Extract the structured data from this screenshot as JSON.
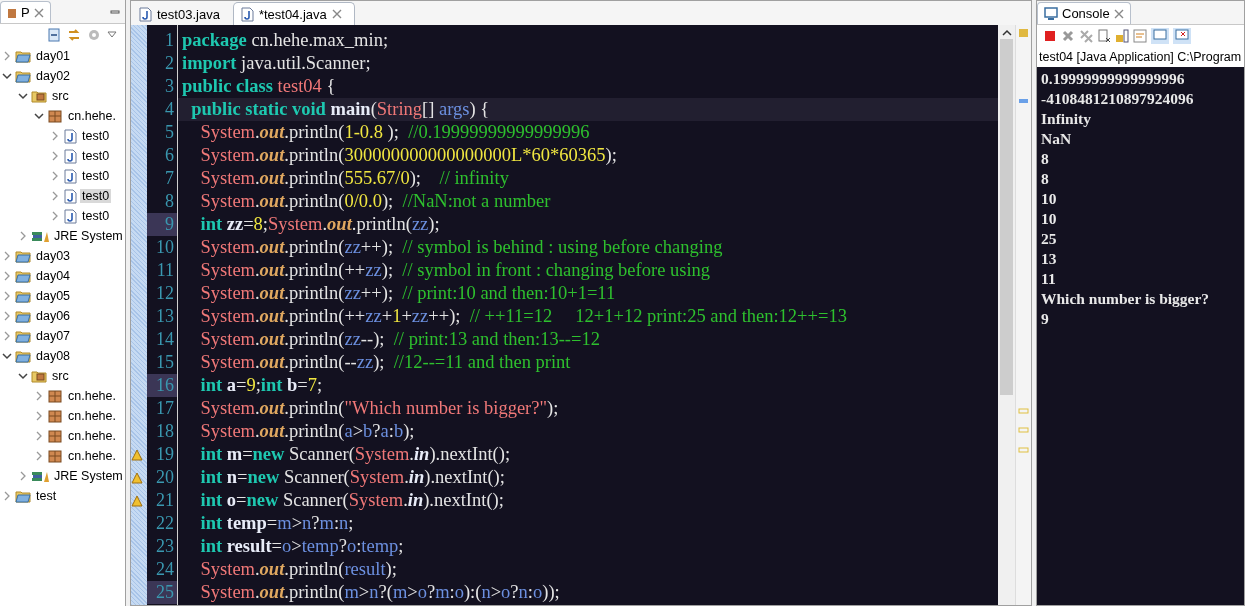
{
  "explorer": {
    "tab": "P",
    "tree": [
      {
        "label": "day01",
        "kind": "project",
        "expanded": false,
        "selected": false
      },
      {
        "label": "day02",
        "kind": "project",
        "expanded": true,
        "selected": false,
        "children": [
          {
            "label": "src",
            "kind": "source-folder",
            "expanded": true,
            "selected": false,
            "children": [
              {
                "label": "cn.hehe.",
                "kind": "package",
                "expanded": true,
                "selected": false,
                "children": [
                  {
                    "label": "test0",
                    "kind": "java-file",
                    "expanded": false,
                    "selected": false
                  },
                  {
                    "label": "test0",
                    "kind": "java-file",
                    "expanded": false,
                    "selected": false
                  },
                  {
                    "label": "test0",
                    "kind": "java-file",
                    "expanded": false,
                    "selected": false
                  },
                  {
                    "label": "test0",
                    "kind": "java-file",
                    "expanded": false,
                    "selected": true
                  },
                  {
                    "label": "test0",
                    "kind": "java-file",
                    "expanded": false,
                    "selected": false
                  }
                ]
              }
            ]
          },
          {
            "label": "JRE System",
            "kind": "library",
            "expanded": false,
            "selected": false
          }
        ]
      },
      {
        "label": "day03",
        "kind": "project",
        "expanded": false,
        "selected": false
      },
      {
        "label": "day04",
        "kind": "project",
        "expanded": false,
        "selected": false
      },
      {
        "label": "day05",
        "kind": "project",
        "expanded": false,
        "selected": false
      },
      {
        "label": "day06",
        "kind": "project",
        "expanded": false,
        "selected": false
      },
      {
        "label": "day07",
        "kind": "project",
        "expanded": false,
        "selected": false
      },
      {
        "label": "day08",
        "kind": "project",
        "expanded": true,
        "selected": false,
        "children": [
          {
            "label": "src",
            "kind": "source-folder",
            "expanded": true,
            "selected": false,
            "children": [
              {
                "label": "cn.hehe.",
                "kind": "package",
                "expanded": false,
                "selected": false
              },
              {
                "label": "cn.hehe.",
                "kind": "package",
                "expanded": false,
                "selected": false
              },
              {
                "label": "cn.hehe.",
                "kind": "package",
                "expanded": false,
                "selected": false
              },
              {
                "label": "cn.hehe.",
                "kind": "package",
                "expanded": false,
                "selected": false
              }
            ]
          },
          {
            "label": "JRE System",
            "kind": "library",
            "expanded": false,
            "selected": false
          }
        ]
      },
      {
        "label": "test",
        "kind": "project",
        "expanded": false,
        "selected": false
      }
    ]
  },
  "editor": {
    "tabs": [
      {
        "label": "test03.java",
        "selected": false
      },
      {
        "label": "*test04.java",
        "selected": true
      }
    ],
    "lines": [
      {
        "number": "1",
        "current": false,
        "marked": false,
        "warning": false,
        "tokens": [
          {
            "kind": "kw",
            "text": "package"
          },
          {
            "kind": "pl",
            "text": " cn.hehe.max_min;"
          }
        ]
      },
      {
        "number": "2",
        "current": false,
        "marked": false,
        "warning": false,
        "tokens": [
          {
            "kind": "kw",
            "text": "import"
          },
          {
            "kind": "pl",
            "text": " java.util.Scanner;"
          }
        ]
      },
      {
        "number": "3",
        "current": false,
        "marked": false,
        "warning": false,
        "tokens": [
          {
            "kind": "kw",
            "text": "public class "
          },
          {
            "kind": "cls",
            "text": "test04"
          },
          {
            "kind": "pl",
            "text": " {"
          }
        ]
      },
      {
        "number": "4",
        "current": true,
        "marked": false,
        "warning": false,
        "tokens": [
          {
            "kind": "kw",
            "text": "  public static void "
          },
          {
            "kind": "dv",
            "text": "main"
          },
          {
            "kind": "pl",
            "text": "("
          },
          {
            "kind": "cls",
            "text": "String"
          },
          {
            "kind": "pl",
            "text": "[] "
          },
          {
            "kind": "var",
            "text": "args"
          },
          {
            "kind": "pl",
            "text": ") {"
          }
        ]
      },
      {
        "number": "5",
        "current": false,
        "marked": false,
        "warning": false,
        "tokens": [
          {
            "kind": "cls",
            "text": "    System"
          },
          {
            "kind": "pl",
            "text": "."
          },
          {
            "kind": "fld",
            "text": "out"
          },
          {
            "kind": "pl",
            "text": ".println("
          },
          {
            "kind": "num",
            "text": "1-0.8"
          },
          {
            "kind": "pl",
            "text": " );  "
          },
          {
            "kind": "cm",
            "text": "//0.19999999999999996"
          }
        ]
      },
      {
        "number": "6",
        "current": false,
        "marked": false,
        "warning": false,
        "tokens": [
          {
            "kind": "cls",
            "text": "    System"
          },
          {
            "kind": "pl",
            "text": "."
          },
          {
            "kind": "fld",
            "text": "out"
          },
          {
            "kind": "pl",
            "text": ".println("
          },
          {
            "kind": "num",
            "text": "300000000000000000L*60*60365"
          },
          {
            "kind": "pl",
            "text": ");"
          }
        ]
      },
      {
        "number": "7",
        "current": false,
        "marked": false,
        "warning": false,
        "tokens": [
          {
            "kind": "cls",
            "text": "    System"
          },
          {
            "kind": "pl",
            "text": "."
          },
          {
            "kind": "fld",
            "text": "out"
          },
          {
            "kind": "pl",
            "text": ".println("
          },
          {
            "kind": "num",
            "text": "555.67/0"
          },
          {
            "kind": "pl",
            "text": ");    "
          },
          {
            "kind": "cm",
            "text": "// infinity"
          }
        ]
      },
      {
        "number": "8",
        "current": false,
        "marked": false,
        "warning": false,
        "tokens": [
          {
            "kind": "cls",
            "text": "    System"
          },
          {
            "kind": "pl",
            "text": "."
          },
          {
            "kind": "fld",
            "text": "out"
          },
          {
            "kind": "pl",
            "text": ".println("
          },
          {
            "kind": "num",
            "text": "0/0.0"
          },
          {
            "kind": "pl",
            "text": ");  "
          },
          {
            "kind": "cm",
            "text": "//NaN:not a number"
          }
        ]
      },
      {
        "number": "9",
        "current": false,
        "marked": true,
        "warning": false,
        "tokens": [
          {
            "kind": "kw",
            "text": "    int "
          },
          {
            "kind": "dv",
            "text": "zz"
          },
          {
            "kind": "pl",
            "text": "="
          },
          {
            "kind": "num",
            "text": "8"
          },
          {
            "kind": "pl",
            "text": ";"
          },
          {
            "kind": "cls",
            "text": "System"
          },
          {
            "kind": "pl",
            "text": "."
          },
          {
            "kind": "fld",
            "text": "out"
          },
          {
            "kind": "pl",
            "text": ".println("
          },
          {
            "kind": "var",
            "text": "zz"
          },
          {
            "kind": "pl",
            "text": ");"
          }
        ]
      },
      {
        "number": "10",
        "current": false,
        "marked": false,
        "warning": false,
        "tokens": [
          {
            "kind": "cls",
            "text": "    System"
          },
          {
            "kind": "pl",
            "text": "."
          },
          {
            "kind": "fld",
            "text": "out"
          },
          {
            "kind": "pl",
            "text": ".println("
          },
          {
            "kind": "var",
            "text": "zz"
          },
          {
            "kind": "pl",
            "text": "++);  "
          },
          {
            "kind": "cm",
            "text": "// symbol is behind : using before changing"
          }
        ]
      },
      {
        "number": "11",
        "current": false,
        "marked": false,
        "warning": false,
        "tokens": [
          {
            "kind": "cls",
            "text": "    System"
          },
          {
            "kind": "pl",
            "text": "."
          },
          {
            "kind": "fld",
            "text": "out"
          },
          {
            "kind": "pl",
            "text": ".println(++"
          },
          {
            "kind": "var",
            "text": "zz"
          },
          {
            "kind": "pl",
            "text": ");  "
          },
          {
            "kind": "cm",
            "text": "// symbol in front : changing before using"
          }
        ]
      },
      {
        "number": "12",
        "current": false,
        "marked": false,
        "warning": false,
        "tokens": [
          {
            "kind": "cls",
            "text": "    System"
          },
          {
            "kind": "pl",
            "text": "."
          },
          {
            "kind": "fld",
            "text": "out"
          },
          {
            "kind": "pl",
            "text": ".println("
          },
          {
            "kind": "var",
            "text": "zz"
          },
          {
            "kind": "pl",
            "text": "++);  "
          },
          {
            "kind": "cm",
            "text": "// print:10 and then:10+1=11"
          }
        ]
      },
      {
        "number": "13",
        "current": false,
        "marked": false,
        "warning": false,
        "tokens": [
          {
            "kind": "cls",
            "text": "    System"
          },
          {
            "kind": "pl",
            "text": "."
          },
          {
            "kind": "fld",
            "text": "out"
          },
          {
            "kind": "pl",
            "text": ".println(++"
          },
          {
            "kind": "var",
            "text": "zz"
          },
          {
            "kind": "pl",
            "text": "+"
          },
          {
            "kind": "num",
            "text": "1"
          },
          {
            "kind": "pl",
            "text": "+"
          },
          {
            "kind": "var",
            "text": "zz"
          },
          {
            "kind": "pl",
            "text": "++);  "
          },
          {
            "kind": "cm",
            "text": "// ++11=12     12+1+12 print:25 and then:12++=13"
          }
        ]
      },
      {
        "number": "14",
        "current": false,
        "marked": false,
        "warning": false,
        "tokens": [
          {
            "kind": "cls",
            "text": "    System"
          },
          {
            "kind": "pl",
            "text": "."
          },
          {
            "kind": "fld",
            "text": "out"
          },
          {
            "kind": "pl",
            "text": ".println("
          },
          {
            "kind": "var",
            "text": "zz"
          },
          {
            "kind": "pl",
            "text": "--);  "
          },
          {
            "kind": "cm",
            "text": "// print:13 and then:13--=12"
          }
        ]
      },
      {
        "number": "15",
        "current": false,
        "marked": false,
        "warning": false,
        "tokens": [
          {
            "kind": "cls",
            "text": "    System"
          },
          {
            "kind": "pl",
            "text": "."
          },
          {
            "kind": "fld",
            "text": "out"
          },
          {
            "kind": "pl",
            "text": ".println(--"
          },
          {
            "kind": "var",
            "text": "zz"
          },
          {
            "kind": "pl",
            "text": ");  "
          },
          {
            "kind": "cm",
            "text": "//12--=11 and then print"
          }
        ]
      },
      {
        "number": "16",
        "current": false,
        "marked": true,
        "warning": false,
        "tokens": [
          {
            "kind": "kw",
            "text": "    int "
          },
          {
            "kind": "dv",
            "text": "a"
          },
          {
            "kind": "pl",
            "text": "="
          },
          {
            "kind": "num",
            "text": "9"
          },
          {
            "kind": "pl",
            "text": ";"
          },
          {
            "kind": "kw",
            "text": "int "
          },
          {
            "kind": "dv",
            "text": "b"
          },
          {
            "kind": "pl",
            "text": "="
          },
          {
            "kind": "num",
            "text": "7"
          },
          {
            "kind": "pl",
            "text": ";"
          }
        ]
      },
      {
        "number": "17",
        "current": false,
        "marked": false,
        "warning": false,
        "tokens": [
          {
            "kind": "cls",
            "text": "    System"
          },
          {
            "kind": "pl",
            "text": "."
          },
          {
            "kind": "fld",
            "text": "out"
          },
          {
            "kind": "pl",
            "text": ".println("
          },
          {
            "kind": "str",
            "text": "\"Which number is bigger?\""
          },
          {
            "kind": "pl",
            "text": ");"
          }
        ]
      },
      {
        "number": "18",
        "current": false,
        "marked": false,
        "warning": false,
        "tokens": [
          {
            "kind": "cls",
            "text": "    System"
          },
          {
            "kind": "pl",
            "text": "."
          },
          {
            "kind": "fld",
            "text": "out"
          },
          {
            "kind": "pl",
            "text": ".println("
          },
          {
            "kind": "var",
            "text": "a"
          },
          {
            "kind": "pl",
            "text": ">"
          },
          {
            "kind": "var",
            "text": "b"
          },
          {
            "kind": "pl",
            "text": "?"
          },
          {
            "kind": "var",
            "text": "a"
          },
          {
            "kind": "pl",
            "text": ":"
          },
          {
            "kind": "var",
            "text": "b"
          },
          {
            "kind": "pl",
            "text": ");"
          }
        ]
      },
      {
        "number": "19",
        "current": false,
        "marked": false,
        "warning": true,
        "tokens": [
          {
            "kind": "kw",
            "text": "    int "
          },
          {
            "kind": "dv",
            "text": "m"
          },
          {
            "kind": "pl",
            "text": "="
          },
          {
            "kind": "kw",
            "text": "new"
          },
          {
            "kind": "pl",
            "text": " Scanner("
          },
          {
            "kind": "cls",
            "text": "System"
          },
          {
            "kind": "pl",
            "text": "."
          },
          {
            "kind": "st",
            "text": "in"
          },
          {
            "kind": "pl",
            "text": ").nextInt();"
          }
        ]
      },
      {
        "number": "20",
        "current": false,
        "marked": false,
        "warning": true,
        "tokens": [
          {
            "kind": "kw",
            "text": "    int "
          },
          {
            "kind": "dv",
            "text": "n"
          },
          {
            "kind": "pl",
            "text": "="
          },
          {
            "kind": "kw",
            "text": "new"
          },
          {
            "kind": "pl",
            "text": " Scanner("
          },
          {
            "kind": "cls",
            "text": "System"
          },
          {
            "kind": "pl",
            "text": "."
          },
          {
            "kind": "st",
            "text": "in"
          },
          {
            "kind": "pl",
            "text": ").nextInt();"
          }
        ]
      },
      {
        "number": "21",
        "current": false,
        "marked": false,
        "warning": true,
        "tokens": [
          {
            "kind": "kw",
            "text": "    int "
          },
          {
            "kind": "dv",
            "text": "o"
          },
          {
            "kind": "pl",
            "text": "="
          },
          {
            "kind": "kw",
            "text": "new"
          },
          {
            "kind": "pl",
            "text": " Scanner("
          },
          {
            "kind": "cls",
            "text": "System"
          },
          {
            "kind": "pl",
            "text": "."
          },
          {
            "kind": "st",
            "text": "in"
          },
          {
            "kind": "pl",
            "text": ").nextInt();"
          }
        ]
      },
      {
        "number": "22",
        "current": false,
        "marked": false,
        "warning": false,
        "tokens": [
          {
            "kind": "kw",
            "text": "    int "
          },
          {
            "kind": "dv",
            "text": "temp"
          },
          {
            "kind": "pl",
            "text": "="
          },
          {
            "kind": "var",
            "text": "m"
          },
          {
            "kind": "pl",
            "text": ">"
          },
          {
            "kind": "var",
            "text": "n"
          },
          {
            "kind": "pl",
            "text": "?"
          },
          {
            "kind": "var",
            "text": "m"
          },
          {
            "kind": "pl",
            "text": ":"
          },
          {
            "kind": "var",
            "text": "n"
          },
          {
            "kind": "pl",
            "text": ";"
          }
        ]
      },
      {
        "number": "23",
        "current": false,
        "marked": false,
        "warning": false,
        "tokens": [
          {
            "kind": "kw",
            "text": "    int "
          },
          {
            "kind": "dv",
            "text": "result"
          },
          {
            "kind": "pl",
            "text": "="
          },
          {
            "kind": "var",
            "text": "o"
          },
          {
            "kind": "pl",
            "text": ">"
          },
          {
            "kind": "var",
            "text": "temp"
          },
          {
            "kind": "pl",
            "text": "?"
          },
          {
            "kind": "var",
            "text": "o"
          },
          {
            "kind": "pl",
            "text": ":"
          },
          {
            "kind": "var",
            "text": "temp"
          },
          {
            "kind": "pl",
            "text": ";"
          }
        ]
      },
      {
        "number": "24",
        "current": false,
        "marked": false,
        "warning": false,
        "tokens": [
          {
            "kind": "cls",
            "text": "    System"
          },
          {
            "kind": "pl",
            "text": "."
          },
          {
            "kind": "fld",
            "text": "out"
          },
          {
            "kind": "pl",
            "text": ".println("
          },
          {
            "kind": "var",
            "text": "result"
          },
          {
            "kind": "pl",
            "text": ");"
          }
        ]
      },
      {
        "number": "25",
        "current": false,
        "marked": true,
        "warning": false,
        "tokens": [
          {
            "kind": "cls",
            "text": "    System"
          },
          {
            "kind": "pl",
            "text": "."
          },
          {
            "kind": "fld",
            "text": "out"
          },
          {
            "kind": "pl",
            "text": ".println("
          },
          {
            "kind": "var",
            "text": "m"
          },
          {
            "kind": "pl",
            "text": ">"
          },
          {
            "kind": "var",
            "text": "n"
          },
          {
            "kind": "pl",
            "text": "?("
          },
          {
            "kind": "var",
            "text": "m"
          },
          {
            "kind": "pl",
            "text": ">"
          },
          {
            "kind": "var",
            "text": "o"
          },
          {
            "kind": "pl",
            "text": "?"
          },
          {
            "kind": "var",
            "text": "m"
          },
          {
            "kind": "pl",
            "text": ":"
          },
          {
            "kind": "var",
            "text": "o"
          },
          {
            "kind": "pl",
            "text": "):("
          },
          {
            "kind": "var",
            "text": "n"
          },
          {
            "kind": "pl",
            "text": ">"
          },
          {
            "kind": "var",
            "text": "o"
          },
          {
            "kind": "pl",
            "text": "?"
          },
          {
            "kind": "var",
            "text": "n"
          },
          {
            "kind": "pl",
            "text": ":"
          },
          {
            "kind": "var",
            "text": "o"
          },
          {
            "kind": "pl",
            "text": "));"
          }
        ]
      }
    ]
  },
  "console": {
    "tab": "Console",
    "launch": "test04 [Java Application] C:\\Program",
    "output": [
      "0.19999999999999996",
      "-4108481210897924096",
      "Infinity",
      "NaN",
      "8",
      "8",
      "10",
      "10",
      "25",
      "13",
      "11",
      "Which number is bigger?",
      "9"
    ]
  }
}
